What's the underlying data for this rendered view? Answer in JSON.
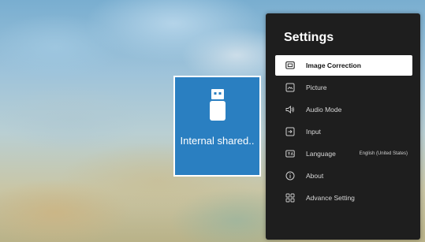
{
  "colors": {
    "card_background": "#2a7fc1",
    "panel_background": "#1e1e1e",
    "selected_background": "#ffffff"
  },
  "source_card": {
    "icon": "usb-drive-icon",
    "label": "Internal shared.."
  },
  "settings": {
    "title": "Settings",
    "items": [
      {
        "label": "Image Correction",
        "icon": "image-correction-icon",
        "selected": true
      },
      {
        "label": "Picture",
        "icon": "picture-icon"
      },
      {
        "label": "Audio Mode",
        "icon": "speaker-icon"
      },
      {
        "label": "Input",
        "icon": "input-icon"
      },
      {
        "label": "Language",
        "icon": "language-icon",
        "value": "English (United States)"
      },
      {
        "label": "About",
        "icon": "info-icon"
      },
      {
        "label": "Advance Setting",
        "icon": "grid-icon"
      }
    ]
  }
}
